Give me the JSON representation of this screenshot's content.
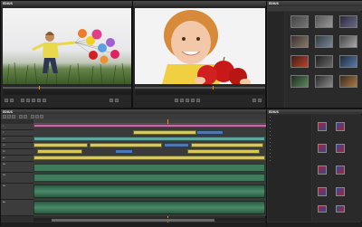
{
  "app": {
    "logo": "EDIUS"
  },
  "player": {
    "logo": "EDIUS",
    "label": "PLR"
  },
  "recorder": {
    "label": "REC"
  },
  "timeline": {
    "logo": "EDIUS",
    "tracks": [
      {
        "name": "1"
      },
      {
        "name": "2"
      },
      {
        "name": "1V"
      },
      {
        "name": "2V"
      },
      {
        "name": "3V"
      },
      {
        "name": "4V"
      },
      {
        "name": "1A"
      },
      {
        "name": "2A"
      },
      {
        "name": "3A"
      },
      {
        "name": "4A"
      }
    ]
  },
  "bin": {
    "logo": "EDIUS"
  },
  "effects": {
    "logo": "EDIUS"
  },
  "colors": {
    "clip_yellow": "#d8c85a",
    "clip_blue": "#4a78b8",
    "clip_teal": "#5aa8a0",
    "clip_pink": "#c86aa8",
    "audio_green": "#3f7a5a",
    "fx_red": "#b02030",
    "fx_blue": "#2a4a9a"
  }
}
